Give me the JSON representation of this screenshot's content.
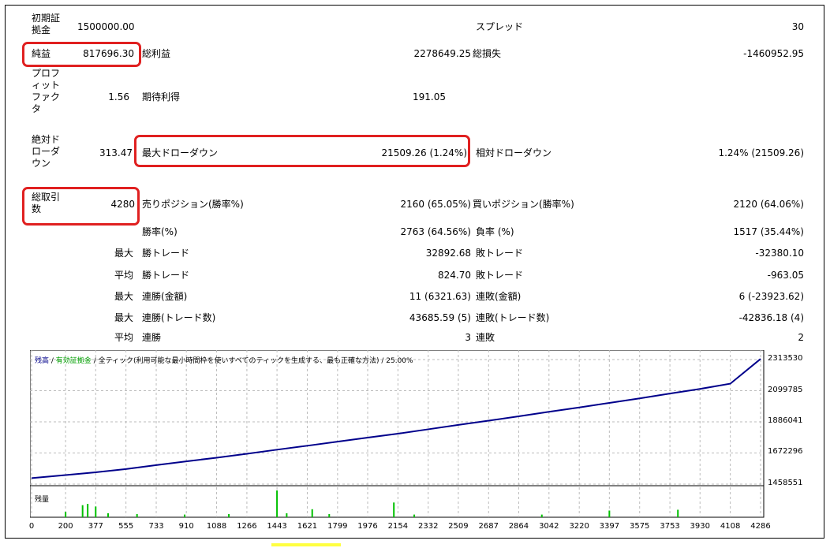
{
  "stats": {
    "initial_deposit": {
      "label": "初期証\n拠金",
      "value": "1500000.00"
    },
    "spread": {
      "label": "スプレッド",
      "value": "30"
    },
    "net_profit": {
      "label": "純益",
      "value": "817696.30"
    },
    "gross_profit": {
      "label": "総利益",
      "value": "2278649.25"
    },
    "gross_loss": {
      "label": "総損失",
      "value": "-1460952.95"
    },
    "profit_factor": {
      "label": "プロフ\nィット\nファク\nタ",
      "value": "1.56"
    },
    "expected_payoff": {
      "label": "期待利得",
      "value": "191.05"
    },
    "absolute_drawdown": {
      "label": "絶対ド\nローダ\nウン",
      "value": "313.47"
    },
    "max_drawdown": {
      "label": "最大ドローダウン",
      "value": "21509.26 (1.24%)"
    },
    "relative_drawdown": {
      "label": "相対ドローダウン",
      "value": "1.24% (21509.26)"
    },
    "total_trades": {
      "label": "総取引\n数",
      "value": "4280"
    },
    "short_positions": {
      "label": "売りポジション(勝率%)",
      "value": "2160 (65.05%)"
    },
    "long_positions": {
      "label": "買いポジション(勝率%)",
      "value": "2120 (64.06%)"
    },
    "win_rate": {
      "label": "勝率(%)",
      "value": "2763 (64.56%)"
    },
    "loss_rate": {
      "label": "負率 (%)",
      "value": "1517 (35.44%)"
    },
    "max_label": "最大",
    "avg_label": "平均",
    "largest_win": {
      "label": "勝トレード",
      "value": "32892.68"
    },
    "largest_loss": {
      "label": "敗トレード",
      "value": "-32380.10"
    },
    "avg_win": {
      "label": "勝トレード",
      "value": "824.70"
    },
    "avg_loss": {
      "label": "敗トレード",
      "value": "-963.05"
    },
    "max_consec_wins_money": {
      "label": "連勝(金額)",
      "value": "11 (6321.63)"
    },
    "max_consec_losses_money": {
      "label": "連敗(金額)",
      "value": "6 (-23923.62)"
    },
    "max_consec_wins_count": {
      "label": "連勝(トレード数)",
      "value": "43685.59 (5)"
    },
    "max_consec_losses_count": {
      "label": "連敗(トレード数)",
      "value": "-42836.18 (4)"
    },
    "avg_consec_wins": {
      "label": "連勝",
      "value": "3"
    },
    "avg_consec_losses": {
      "label": "連敗",
      "value": "2"
    }
  },
  "chart_header": {
    "balance": "残高",
    "sep1": " / ",
    "equity": "有効証拠金",
    "sep2": " / ",
    "rest": "全ティック(利用可能な最小時間枠を使いすべてのティックを生成する、最も正確な方法) / 25.00%",
    "volume": "残量"
  },
  "colors": {
    "balance": "#00008b",
    "equity": "#00a000",
    "volume": "#00c000",
    "highlight": "#e02020"
  },
  "chart_data": {
    "type": "line",
    "y_ticks": [
      2313530,
      2099785,
      1886041,
      1672296,
      1458551
    ],
    "ylim": [
      1458551,
      2313530
    ],
    "x_ticks": [
      0,
      200,
      377,
      555,
      733,
      910,
      1088,
      1266,
      1443,
      1621,
      1799,
      1976,
      2154,
      2332,
      2509,
      2687,
      2864,
      3042,
      3220,
      3397,
      3575,
      3753,
      3930,
      4108,
      4286
    ],
    "xlim": [
      0,
      4286
    ],
    "series": [
      {
        "values_x": [
          0,
          200,
          377,
          555,
          733,
          910,
          1088,
          1266,
          1443,
          1621,
          1799,
          1976,
          2154,
          2332,
          2509,
          2687,
          2864,
          3042,
          3220,
          3397,
          3575,
          3753,
          3930,
          4108,
          4286
        ],
        "values_y": [
          1500000,
          1521000,
          1540000,
          1562000,
          1589000,
          1615000,
          1640000,
          1667000,
          1695000,
          1722000,
          1750000,
          1778000,
          1805000,
          1835000,
          1865000,
          1894000,
          1924000,
          1955000,
          1985000,
          2016000,
          2047000,
          2080000,
          2112000,
          2148000,
          2318000
        ]
      }
    ],
    "volume_spikes": [
      {
        "x": 200,
        "h": 0.2
      },
      {
        "x": 300,
        "h": 0.45
      },
      {
        "x": 330,
        "h": 0.5
      },
      {
        "x": 377,
        "h": 0.4
      },
      {
        "x": 450,
        "h": 0.15
      },
      {
        "x": 620,
        "h": 0.12
      },
      {
        "x": 900,
        "h": 0.1
      },
      {
        "x": 1160,
        "h": 0.12
      },
      {
        "x": 1443,
        "h": 1.0
      },
      {
        "x": 1500,
        "h": 0.15
      },
      {
        "x": 1650,
        "h": 0.3
      },
      {
        "x": 1750,
        "h": 0.12
      },
      {
        "x": 2130,
        "h": 0.55
      },
      {
        "x": 2250,
        "h": 0.1
      },
      {
        "x": 3000,
        "h": 0.1
      },
      {
        "x": 3397,
        "h": 0.25
      },
      {
        "x": 3800,
        "h": 0.28
      }
    ]
  }
}
